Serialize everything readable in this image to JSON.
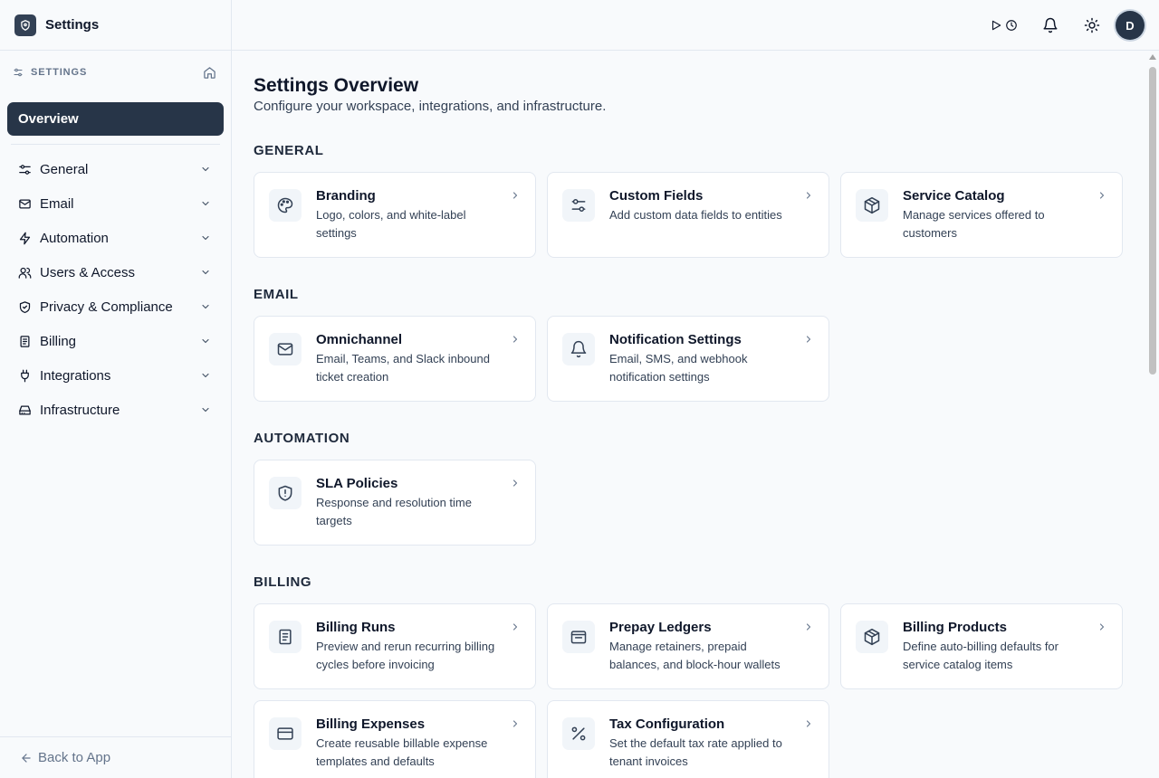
{
  "app": {
    "title": "Settings"
  },
  "sidebar": {
    "section_label": "SETTINGS",
    "overview_label": "Overview",
    "items": [
      {
        "label": "General",
        "icon": "sliders-icon"
      },
      {
        "label": "Email",
        "icon": "mail-icon"
      },
      {
        "label": "Automation",
        "icon": "zap-icon"
      },
      {
        "label": "Users & Access",
        "icon": "users-icon"
      },
      {
        "label": "Privacy & Compliance",
        "icon": "shield-icon"
      },
      {
        "label": "Billing",
        "icon": "receipt-icon"
      },
      {
        "label": "Integrations",
        "icon": "plug-icon"
      },
      {
        "label": "Infrastructure",
        "icon": "hard-drive-icon"
      }
    ],
    "back_label": "Back to App"
  },
  "topbar": {
    "avatar_initial": "D"
  },
  "main": {
    "title": "Settings Overview",
    "subtitle": "Configure your workspace, integrations, and infrastructure.",
    "groups": [
      {
        "title": "GENERAL",
        "cards": [
          {
            "title": "Branding",
            "desc": "Logo, colors, and white-label settings",
            "icon": "palette-icon"
          },
          {
            "title": "Custom Fields",
            "desc": "Add custom data fields to entities",
            "icon": "sliders-icon"
          },
          {
            "title": "Service Catalog",
            "desc": "Manage services offered to customers",
            "icon": "package-icon"
          }
        ]
      },
      {
        "title": "EMAIL",
        "cards": [
          {
            "title": "Omnichannel",
            "desc": "Email, Teams, and Slack inbound ticket creation",
            "icon": "mail-icon"
          },
          {
            "title": "Notification Settings",
            "desc": "Email, SMS, and webhook notification settings",
            "icon": "bell-icon"
          }
        ]
      },
      {
        "title": "AUTOMATION",
        "cards": [
          {
            "title": "SLA Policies",
            "desc": "Response and resolution time targets",
            "icon": "shield-alert-icon"
          }
        ]
      },
      {
        "title": "BILLING",
        "cards": [
          {
            "title": "Billing Runs",
            "desc": "Preview and rerun recurring billing cycles before invoicing",
            "icon": "receipt-icon"
          },
          {
            "title": "Prepay Ledgers",
            "desc": "Manage retainers, prepaid balances, and block-hour wallets",
            "icon": "wallet-icon"
          },
          {
            "title": "Billing Products",
            "desc": "Define auto-billing defaults for service catalog items",
            "icon": "package-icon"
          },
          {
            "title": "Billing Expenses",
            "desc": "Create reusable billable expense templates and defaults",
            "icon": "credit-card-icon"
          },
          {
            "title": "Tax Configuration",
            "desc": "Set the default tax rate applied to tenant invoices",
            "icon": "percent-icon"
          }
        ]
      }
    ]
  }
}
